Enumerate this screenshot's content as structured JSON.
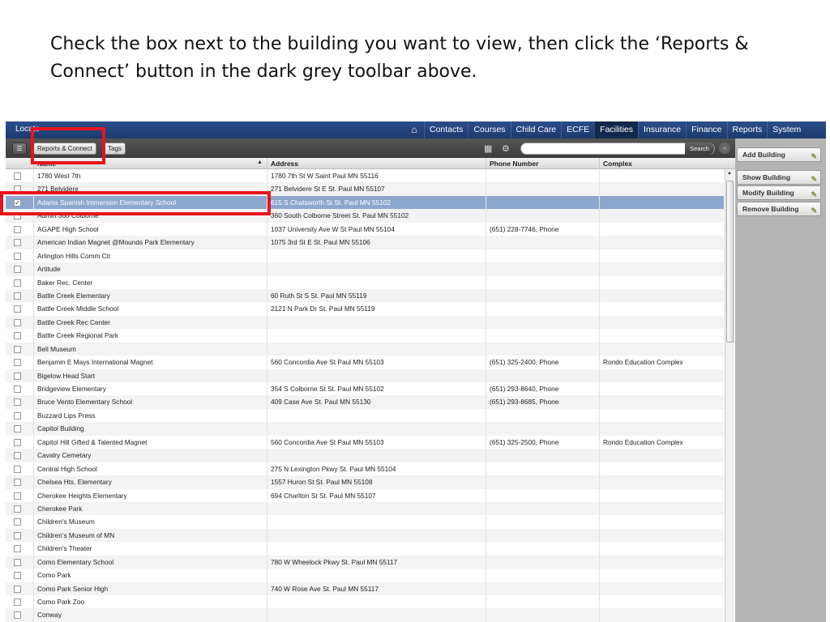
{
  "instruction": "Check the box next to the building you want to view, then click the ‘Reports & Connect’ button in the dark grey toolbar above.",
  "nav": {
    "left_label": "Locate",
    "items": [
      "Contacts",
      "Courses",
      "Child Care",
      "ECFE",
      "Facilities",
      "Insurance",
      "Finance",
      "Reports",
      "System"
    ],
    "active": "Facilities"
  },
  "toolbar": {
    "reports_label": "Reports & Connect",
    "tags_label": "Tags",
    "search_label": "Search"
  },
  "columns": [
    "Name",
    "Address",
    "Phone Number",
    "Complex"
  ],
  "rows": [
    {
      "name": "1780 West 7th",
      "address": "1780 7th St W Saint Paul MN 55116",
      "phone": "",
      "complex": "",
      "checked": false
    },
    {
      "name": "271 Belvidere",
      "address": "271 Belvidere St E St. Paul MN 55107",
      "phone": "",
      "complex": "",
      "checked": false
    },
    {
      "name": "Adams Spanish Immersion Elementary School",
      "address": "615 S Chatsworth St St. Paul MN 55102",
      "phone": "",
      "complex": "",
      "checked": true
    },
    {
      "name": "Admin 360 Colborne",
      "address": "360 South Colborne Street St. Paul MN 55102",
      "phone": "",
      "complex": "",
      "checked": false
    },
    {
      "name": "AGAPE High School",
      "address": "1037 University Ave W St Paul MN 55104",
      "phone": "(651) 228-7746, Phone",
      "complex": "",
      "checked": false
    },
    {
      "name": "American Indian Magnet @Mounds Park Elementary",
      "address": "1075 3rd St E St. Paul MN 55106",
      "phone": "",
      "complex": "",
      "checked": false
    },
    {
      "name": "Arlington Hills Comm Ctr",
      "address": "",
      "phone": "",
      "complex": "",
      "checked": false
    },
    {
      "name": "Artitude",
      "address": "",
      "phone": "",
      "complex": "",
      "checked": false
    },
    {
      "name": "Baker Rec. Center",
      "address": "",
      "phone": "",
      "complex": "",
      "checked": false
    },
    {
      "name": "Battle Creek Elementary",
      "address": "60 Ruth St S St. Paul MN 55119",
      "phone": "",
      "complex": "",
      "checked": false
    },
    {
      "name": "Battle Creek Middle School",
      "address": "2121 N Park Dr St. Paul MN 55119",
      "phone": "",
      "complex": "",
      "checked": false
    },
    {
      "name": "Battle Creek Rec Center",
      "address": "",
      "phone": "",
      "complex": "",
      "checked": false
    },
    {
      "name": "Battle Creek Regional Park",
      "address": "",
      "phone": "",
      "complex": "",
      "checked": false
    },
    {
      "name": "Bell Museum",
      "address": "",
      "phone": "",
      "complex": "",
      "checked": false
    },
    {
      "name": "Benjamin E Mays International Magnet",
      "address": "560 Concordia Ave St Paul MN 55103",
      "phone": "(651) 325-2400, Phone",
      "complex": "Rondo Education Complex",
      "checked": false
    },
    {
      "name": "Bigelow Head Start",
      "address": "",
      "phone": "",
      "complex": "",
      "checked": false
    },
    {
      "name": "Bridgeview Elementary",
      "address": "354 S Colborne St St. Paul MN 55102",
      "phone": "(651) 293-8640, Phone",
      "complex": "",
      "checked": false
    },
    {
      "name": "Bruce Vento Elementary School",
      "address": "409 Case Ave St. Paul MN 55130",
      "phone": "(651) 293-8685, Phone",
      "complex": "",
      "checked": false
    },
    {
      "name": "Buzzard Lips Press",
      "address": "",
      "phone": "",
      "complex": "",
      "checked": false
    },
    {
      "name": "Capitol Building",
      "address": "",
      "phone": "",
      "complex": "",
      "checked": false
    },
    {
      "name": "Capitol Hill Gifted & Talented Magnet",
      "address": "560 Concordia Ave St Paul MN 55103",
      "phone": "(651) 325-2500, Phone",
      "complex": "Rondo Education Complex",
      "checked": false
    },
    {
      "name": "Cavalry Cemetary",
      "address": "",
      "phone": "",
      "complex": "",
      "checked": false
    },
    {
      "name": "Central High School",
      "address": "275 N Lexington Pkwy St. Paul MN 55104",
      "phone": "",
      "complex": "",
      "checked": false
    },
    {
      "name": "Chelsea Hts. Elementary",
      "address": "1557 Huron St St. Paul MN 55108",
      "phone": "",
      "complex": "",
      "checked": false
    },
    {
      "name": "Cherokee Heights Elementary",
      "address": "694 Charlton St St. Paul MN 55107",
      "phone": "",
      "complex": "",
      "checked": false
    },
    {
      "name": "Cherokee Park",
      "address": "",
      "phone": "",
      "complex": "",
      "checked": false
    },
    {
      "name": "Children's Museum",
      "address": "",
      "phone": "",
      "complex": "",
      "checked": false
    },
    {
      "name": "Children's Museum of MN",
      "address": "",
      "phone": "",
      "complex": "",
      "checked": false
    },
    {
      "name": "Children's Theater",
      "address": "",
      "phone": "",
      "complex": "",
      "checked": false
    },
    {
      "name": "Como Elementary School",
      "address": "780 W Wheelock Pkwy St. Paul MN 55117",
      "phone": "",
      "complex": "",
      "checked": false
    },
    {
      "name": "Como Park",
      "address": "",
      "phone": "",
      "complex": "",
      "checked": false
    },
    {
      "name": "Como Park Senior High",
      "address": "740 W Rose Ave St. Paul MN 55117",
      "phone": "",
      "complex": "",
      "checked": false
    },
    {
      "name": "Como Park Zoo",
      "address": "",
      "phone": "",
      "complex": "",
      "checked": false
    },
    {
      "name": "Conway",
      "address": "",
      "phone": "",
      "complex": "",
      "checked": false
    }
  ],
  "side_buttons": [
    "Add Building",
    "Show Building",
    "Modify Building",
    "Remove Building"
  ],
  "colors": {
    "nav": "#1c3a6d",
    "selected_row": "#8ea7cf",
    "highlight": "#e8141c"
  }
}
